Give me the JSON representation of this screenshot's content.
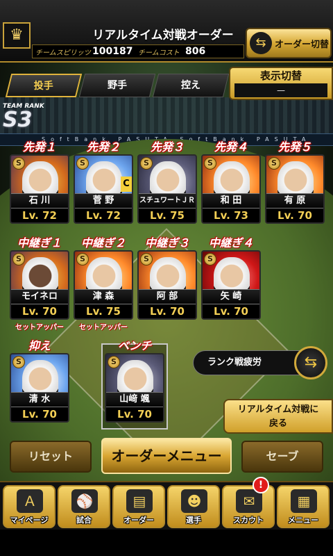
{
  "header": {
    "title": "リアルタイム対戦オーダー",
    "team_spirit_label": "チームスピリッツ",
    "team_spirit_value": "100187",
    "team_cost_label": "チームコスト",
    "team_cost_value": "806",
    "order_switch_label": "オーダー切替"
  },
  "tabs": [
    "投手",
    "野手",
    "控え"
  ],
  "display_switch": {
    "label": "表示切替",
    "value": "—"
  },
  "team_rank": {
    "label": "TEAM RANK",
    "value": "S3"
  },
  "adboard_text": "SoftBank  PASUTA  SoftBank  PASUTA",
  "starters": [
    {
      "pos": "先発１",
      "name": "石 川",
      "lv": "Lv. 72",
      "coin": "S"
    },
    {
      "pos": "先発２",
      "name": "菅 野",
      "lv": "Lv. 72",
      "coin": "S",
      "captain": "C"
    },
    {
      "pos": "先発３",
      "name": "スチュワートＪＲ",
      "lv": "Lv. 75",
      "coin": "S"
    },
    {
      "pos": "先発４",
      "name": "和 田",
      "lv": "Lv. 73",
      "coin": "S"
    },
    {
      "pos": "先発５",
      "name": "有 原",
      "lv": "Lv. 70",
      "coin": "S"
    }
  ],
  "relievers": [
    {
      "pos": "中継ぎ１",
      "name": "モイネロ",
      "lv": "Lv. 70",
      "coin": "S",
      "sub": "セットアッパー"
    },
    {
      "pos": "中継ぎ２",
      "name": "津 森",
      "lv": "Lv. 75",
      "coin": "S",
      "sub": "セットアッパー"
    },
    {
      "pos": "中継ぎ３",
      "name": "阿 部",
      "lv": "Lv. 70",
      "coin": "S"
    },
    {
      "pos": "中継ぎ４",
      "name": "矢 崎",
      "lv": "Lv. 70",
      "coin": "S"
    }
  ],
  "closer": {
    "pos": "抑え",
    "name": "清 水",
    "lv": "Lv. 70",
    "coin": "S"
  },
  "bench": {
    "pos": "ベンチ",
    "name": "山﨑 颯",
    "lv": "Lv. 70",
    "coin": "S"
  },
  "fatigue_label": "ランク戦疲労",
  "back_button": "リアルタイム対戦に\n戻る",
  "buttons": {
    "reset": "リセット",
    "order_menu": "オーダーメニュー",
    "save": "セーブ"
  },
  "nav": [
    "マイページ",
    "試合",
    "オーダー",
    "選手",
    "スカウト",
    "メニュー"
  ],
  "nav_badge": "!",
  "colors": {
    "gold": "#d7a935",
    "accent_red": "#d01a1a"
  }
}
